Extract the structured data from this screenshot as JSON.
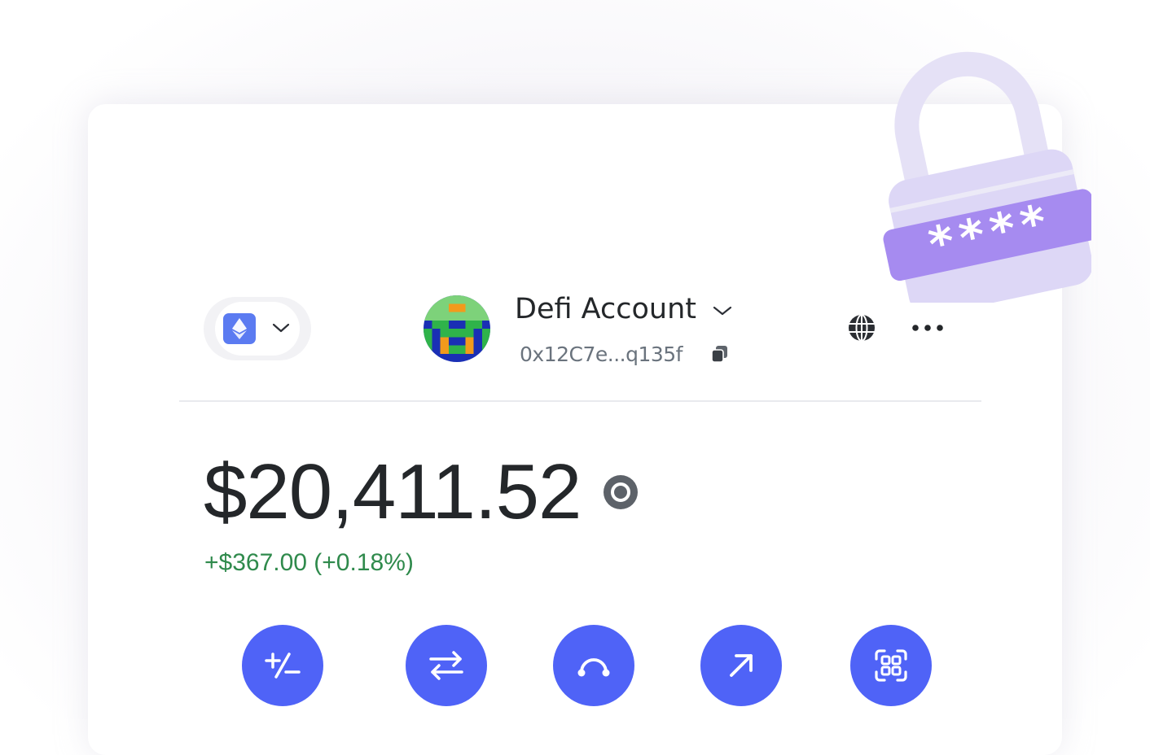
{
  "network": {
    "icon": "ethereum-icon",
    "chevron": "chevron-down-icon"
  },
  "account": {
    "name": "Defi Account",
    "address": "0x12C7e...q135f",
    "copy_icon": "copy-icon"
  },
  "header_actions": {
    "globe_icon": "globe-icon",
    "more_icon": "more-horizontal-icon"
  },
  "balance": {
    "amount": "$20,411.52",
    "change": "+$367.00 (+0.18%)",
    "visibility_icon": "eye-icon"
  },
  "actions": [
    {
      "icon": "buy-sell-icon"
    },
    {
      "icon": "swap-icon"
    },
    {
      "icon": "bridge-icon"
    },
    {
      "icon": "send-icon"
    },
    {
      "icon": "scan-qr-icon"
    }
  ],
  "decoration": {
    "lock_icon": "padlock-password-icon",
    "mask": "****"
  },
  "colors": {
    "accent": "#4f63f7",
    "positive": "#2f8a4c",
    "text": "#24272a",
    "muted": "#6a737d",
    "lock_body": "#d9d3f5",
    "lock_band": "#a78cf0",
    "eth": "#5b7bf1"
  }
}
